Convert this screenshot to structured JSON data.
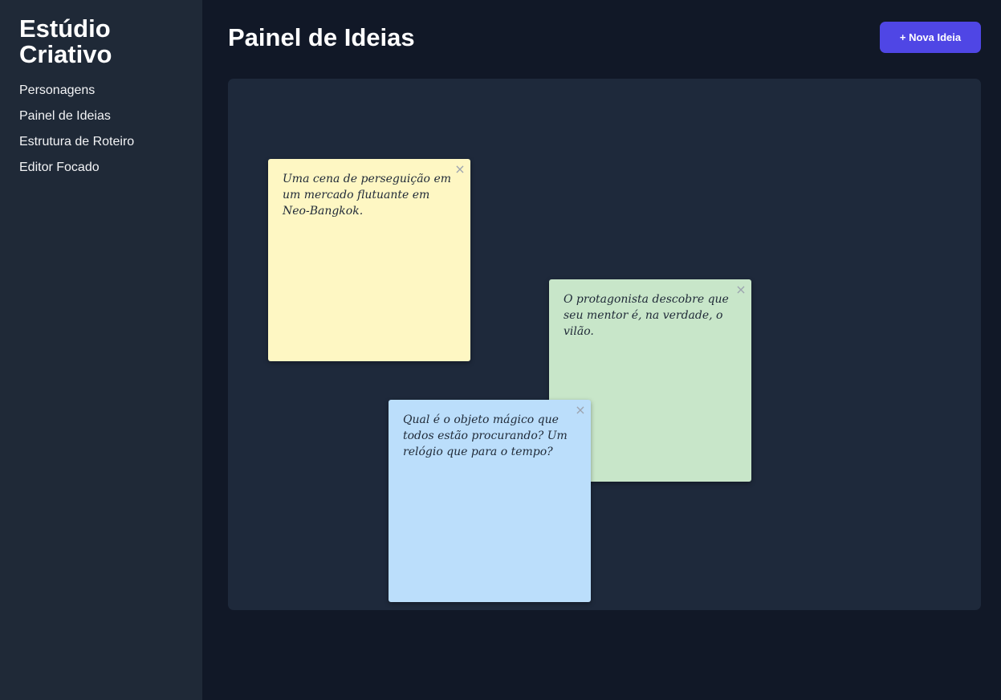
{
  "sidebar": {
    "brand_line1": "Estúdio",
    "brand_line2": "Criativo",
    "items": [
      {
        "label": "Personagens"
      },
      {
        "label": "Painel de Ideias"
      },
      {
        "label": "Estrutura de Roteiro"
      },
      {
        "label": "Editor Focado"
      }
    ]
  },
  "header": {
    "title": "Painel de Ideias",
    "new_idea_label": "+ Nova Ideia"
  },
  "board": {
    "notes": [
      {
        "text": "Uma cena de perseguição em um mercado flutuante em Neo-Bangkok.",
        "color": "#fef7c3",
        "close": "×"
      },
      {
        "text": "O protagonista descobre que seu mentor é, na verdade, o vilão.",
        "color": "#c8e6c9",
        "close": "×"
      },
      {
        "text": "Qual é o objeto mágico que todos estão procurando? Um relógio que para o tempo?",
        "color": "#bbdefb",
        "close": "×"
      }
    ]
  },
  "colors": {
    "sidebar_bg": "#1f2937",
    "page_bg": "#111827",
    "board_bg": "#1e293b",
    "accent": "#4f46e5"
  }
}
